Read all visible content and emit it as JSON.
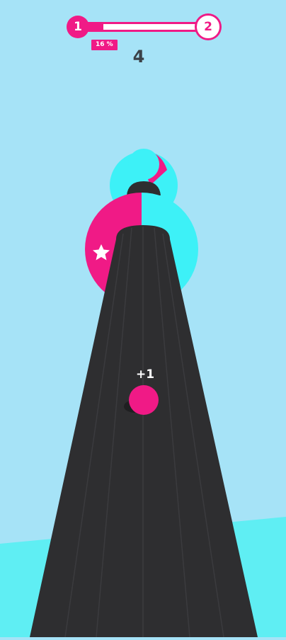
{
  "hud": {
    "level_current": "1",
    "level_next": "2",
    "progress_percent": 16,
    "progress_label": "16 %",
    "score": "4"
  },
  "game": {
    "pickup_label": "+1"
  },
  "colors": {
    "sky": "#a6e3f7",
    "magenta": "#f01a86",
    "cyan": "#3df1f7",
    "track": "#2e2e30",
    "track_line": "#3a3a3c",
    "ground": "#5feef3"
  },
  "icons": [
    "star-icon"
  ]
}
